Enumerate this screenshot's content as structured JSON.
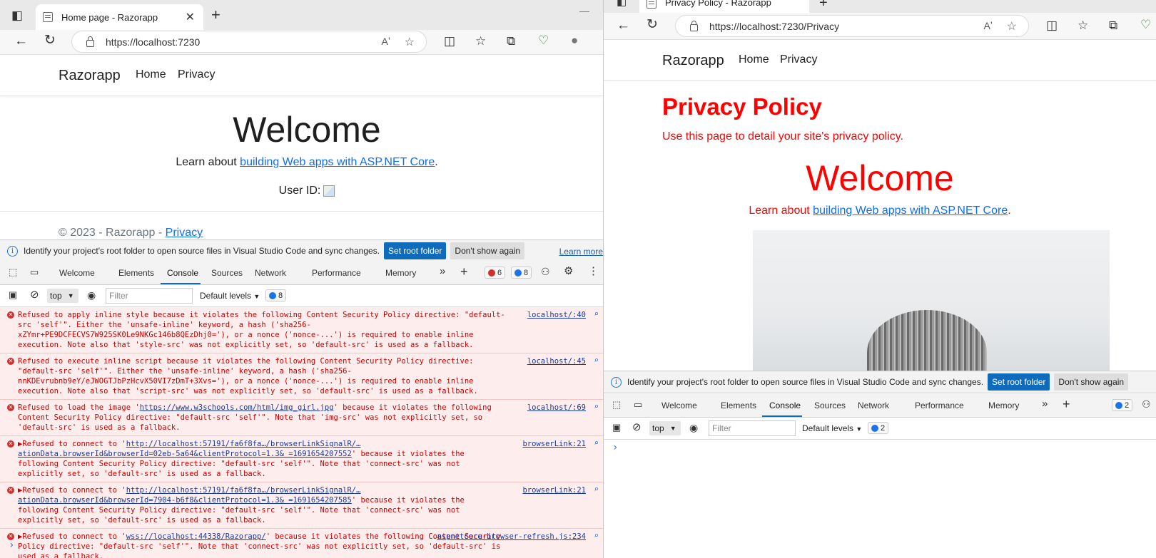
{
  "left": {
    "tab_title": "Home page - Razorapp",
    "url": "https://localhost:7230",
    "brand": "Razorapp",
    "nav": [
      "Home",
      "Privacy"
    ],
    "welcome": "Welcome",
    "learn_prefix": "Learn about ",
    "learn_link": "building Web apps with ASP.NET Core",
    "learn_suffix": ".",
    "user_id": "User ID:",
    "footer_prefix": "© 2023 - Razorapp - ",
    "footer_link": "Privacy",
    "infobar_text": "Identify your project's root folder to open source files in Visual Studio Code and sync changes.",
    "infobar_btn1": "Set root folder",
    "infobar_btn2": "Don't show again",
    "infobar_learn": "Learn more",
    "devtools_tabs": [
      "Welcome",
      "Elements",
      "Console",
      "Sources",
      "Network",
      "Performance",
      "Memory"
    ],
    "error_count": "6",
    "message_count": "8",
    "context": "top",
    "filter_placeholder": "Filter",
    "levels": "Default levels",
    "issues_count": "8",
    "errors": [
      {
        "parts": [
          {
            "t": "Refused to apply inline style because it violates the following Content Security Policy directive: \"default-src 'self'\". Either the 'unsafe-inline' keyword, a hash ('sha256-xZYmr+PE9DCFECVS7W925SK0Le9NKGc146b8QEzDhj0='), or a nonce ('nonce-...') is required to enable inline execution. Note also that 'style-src' was not explicitly set, so 'default-src' is used as a fallback.",
            "u": false
          }
        ],
        "source": "localhost/:40"
      },
      {
        "parts": [
          {
            "t": "Refused to execute inline script because it violates the following Content Security Policy directive: \"default-src 'self'\". Either the 'unsafe-inline' keyword, a hash ('sha256-nnKDEvrubnb9eY/eJWOGTJbPzHcvX50VI7zDmT+3Xvs='), or a nonce ('nonce-...') is required to enable inline execution. Note also that 'script-src' was not explicitly set, so 'default-src' is used as a fallback.",
            "u": false
          }
        ],
        "source": "localhost/:45"
      },
      {
        "parts": [
          {
            "t": "Refused to load the image '",
            "u": false
          },
          {
            "t": "https://www.w3schools.com/html/img_girl.jpg",
            "u": true
          },
          {
            "t": "' because it violates the following Content Security Policy directive: \"default-src 'self'\". Note that 'img-src' was not explicitly set, so 'default-src' is used as a fallback.",
            "u": false
          }
        ],
        "source": "localhost/:69"
      },
      {
        "parts": [
          {
            "t": "▶Refused to connect to '",
            "u": false
          },
          {
            "t": "http://localhost:57191/fa6f8fa…/browserLinkSignalR/…ationData.browserId&browserId=02eb-5a64&clientProtocol=1.3& =1691654207552",
            "u": true
          },
          {
            "t": "' because it violates the following Content Security Policy directive: \"default-src 'self'\". Note that 'connect-src' was not explicitly set, so 'default-src' is used as a fallback.",
            "u": false
          }
        ],
        "source": "browserLink:21"
      },
      {
        "parts": [
          {
            "t": "▶Refused to connect to '",
            "u": false
          },
          {
            "t": "http://localhost:57191/fa6f8fa…/browserLinkSignalR/…ationData.browserId&browserId=7904-b6f8&clientProtocol=1.3& =1691654207585",
            "u": true
          },
          {
            "t": "' because it violates the following Content Security Policy directive: \"default-src 'self'\". Note that 'connect-src' was not explicitly set, so 'default-src' is used as a fallback.",
            "u": false
          }
        ],
        "source": "browserLink:21"
      },
      {
        "parts": [
          {
            "t": "▶Refused to connect to '",
            "u": false
          },
          {
            "t": "wss://localhost:44338/Razorapp/",
            "u": true
          },
          {
            "t": "' because it violates the following Content Security Policy directive: \"default-src 'self'\". Note that 'connect-src' was not explicitly set, so 'default-src' is used as a fallback.",
            "u": false
          }
        ],
        "source": "aspnetcore-browser-refresh.js:234"
      }
    ],
    "prompt": "›"
  },
  "right": {
    "tab_title": "Privacy Policy - Razorapp",
    "url": "https://localhost:7230/Privacy",
    "brand": "Razorapp",
    "nav": [
      "Home",
      "Privacy"
    ],
    "heading": "Privacy Policy",
    "subtext": "Use this page to detail your site's privacy policy.",
    "welcome": "Welcome",
    "learn_prefix": "Learn about ",
    "learn_link": "building Web apps with ASP.NET Core",
    "learn_suffix": ".",
    "infobar_text": "Identify your project's root folder to open source files in Visual Studio Code and sync changes.",
    "infobar_btn1": "Set root folder",
    "infobar_btn2": "Don't show again",
    "devtools_tabs": [
      "Welcome",
      "Elements",
      "Console",
      "Sources",
      "Network",
      "Performance",
      "Memory"
    ],
    "message_count": "2",
    "context": "top",
    "filter_placeholder": "Filter",
    "levels": "Default levels",
    "issues_count": "2",
    "prompt": "›"
  },
  "icons": {
    "tab_actions": "tab-actions-icon",
    "back": "back-icon",
    "refresh": "refresh-icon",
    "read_aloud": "read-aloud-icon",
    "favorite": "favorite-icon",
    "split": "split-screen-icon",
    "favorites": "favorites-icon",
    "collections": "collections-icon",
    "health": "browser-essentials-icon",
    "profile": "profile-icon"
  },
  "colors": {
    "accent": "#0f6cbd",
    "link": "#0d6efd",
    "error_bg": "#fdeded",
    "error_text": "#cc0000",
    "privacy_red": "#ff0000"
  }
}
